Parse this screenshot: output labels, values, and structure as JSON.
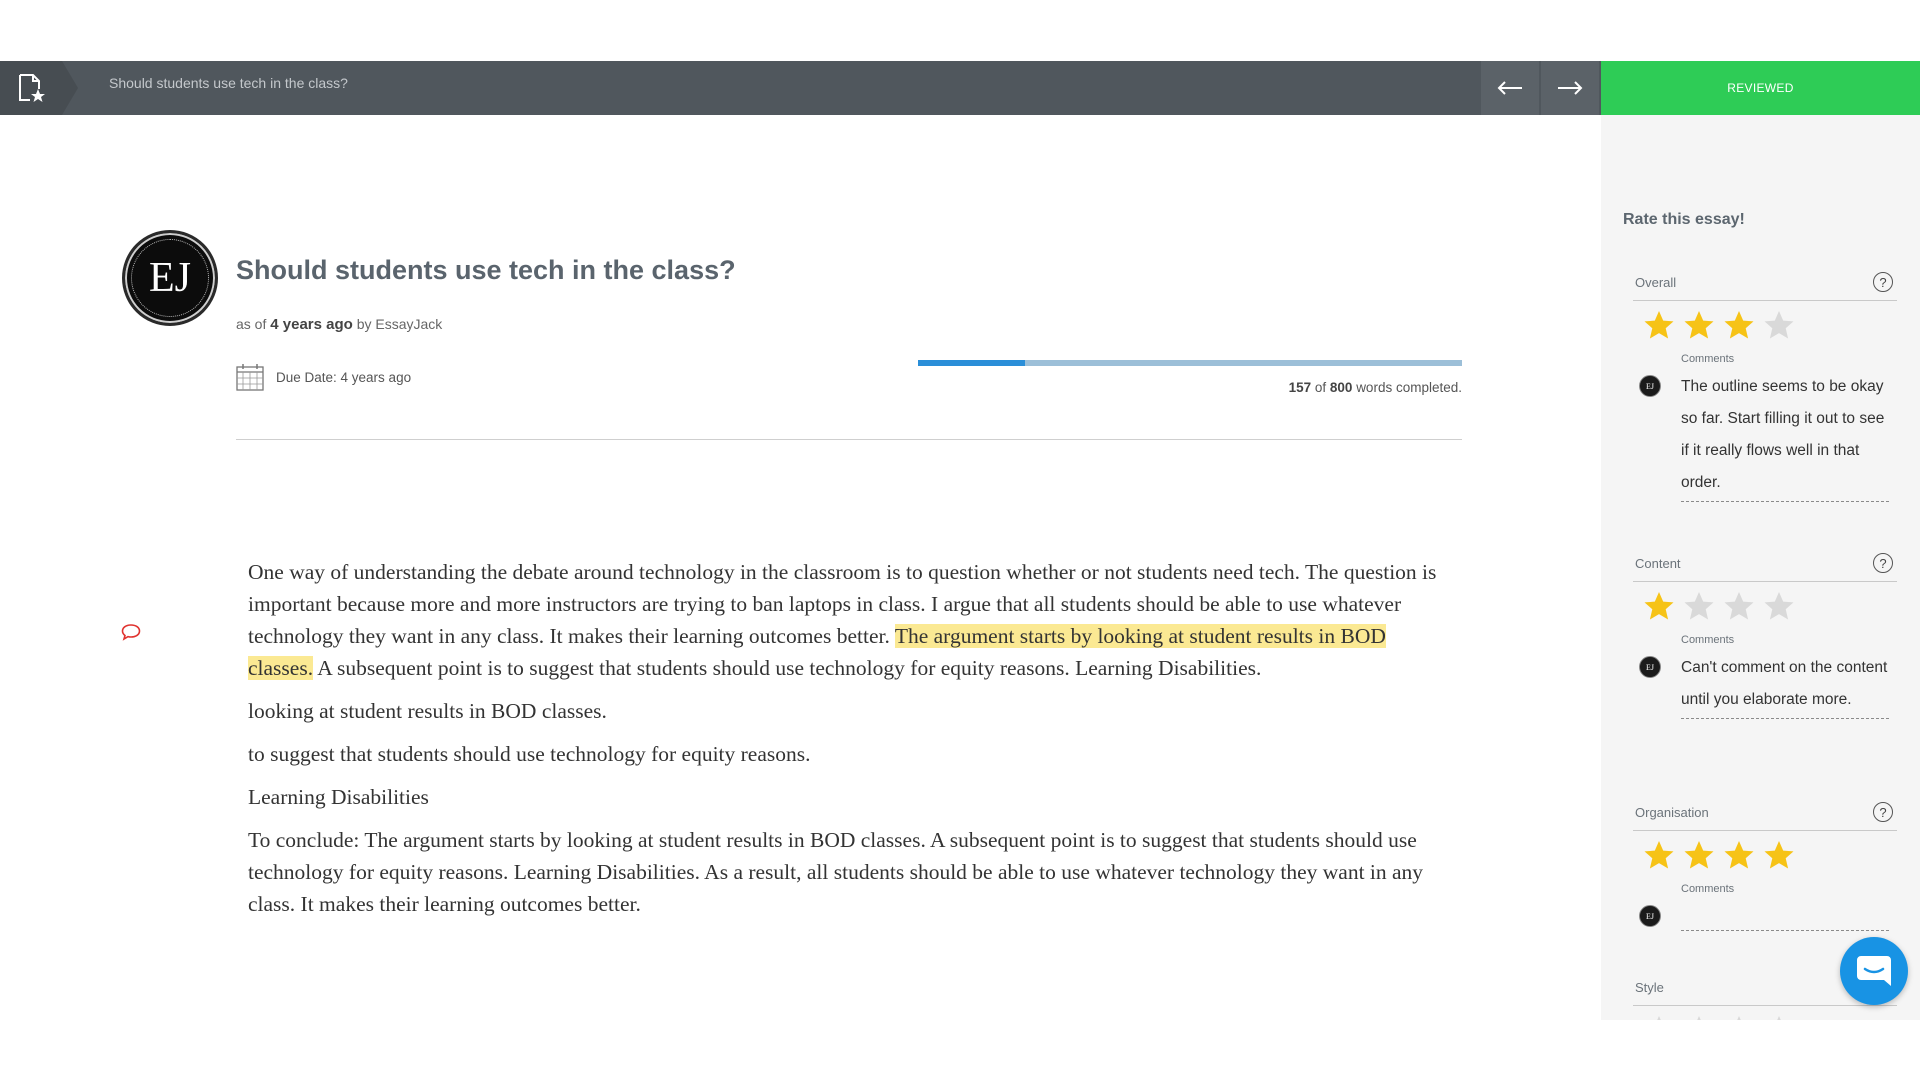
{
  "topbar": {
    "title": "Should students use tech in the class?",
    "reviewed_label": "REVIEWED",
    "back_icon": "arrow-left-icon",
    "forward_icon": "arrow-right-icon",
    "doc_icon": "document-star-icon"
  },
  "essay": {
    "logo_text": "EJ",
    "title": "Should students use tech in the class?",
    "meta_prefix": "as of",
    "meta_time": "4 years ago",
    "meta_by": "by EssayJack",
    "due_date": "Due Date: 4 years ago",
    "progress": {
      "words_done": "157",
      "of_label": "of",
      "words_total": "800",
      "suffix": "words completed.",
      "fraction": 0.196
    },
    "paragraphs": {
      "p1_before": "One way of understanding the debate around technology in the classroom is to question whether or not students need tech. The question is important because more and more instructors are trying to ban laptops in class. I argue that all students should be able to use whatever technology they want in any class. It makes their learning outcomes better. ",
      "p1_highlight": "The argument starts by looking at student results in BOD classes.",
      "p1_after": " A subsequent point is to suggest that students should use technology for equity reasons. Learning Disabilities.",
      "p2": "looking at student results in BOD classes.",
      "p3": "to suggest that students should use technology for equity reasons.",
      "p4": "Learning Disabilities",
      "p5": "To conclude: The argument starts by looking at student results in BOD classes. A subsequent point is to suggest that students should use technology for equity reasons. Learning Disabilities. As a result, all students should be able to use whatever technology they want in any class. It makes their learning outcomes better."
    }
  },
  "sidebar": {
    "title": "Rate this essay!",
    "comments_label": "Comments",
    "avatar_text": "EJ",
    "sections": [
      {
        "label": "Overall",
        "stars": 3,
        "max": 4,
        "comment": "The outline seems to be okay so far. Start filling it out to see if it really flows well in that order."
      },
      {
        "label": "Content",
        "stars": 1,
        "max": 4,
        "comment": "Can't comment on the content until you elaborate more."
      },
      {
        "label": "Organisation",
        "stars": 4,
        "max": 4,
        "comment": ""
      },
      {
        "label": "Style",
        "stars": 0,
        "max": 4,
        "comment": ""
      }
    ]
  },
  "colors": {
    "topbar": "#50575d",
    "reviewed": "#2ecc56",
    "star_filled": "#f6c317",
    "star_empty": "#d9d9d9",
    "highlight": "#fbe993",
    "progress_fill": "#2a8ed8",
    "chat": "#1893e4"
  },
  "chat_icon": "chat-bubble-icon"
}
